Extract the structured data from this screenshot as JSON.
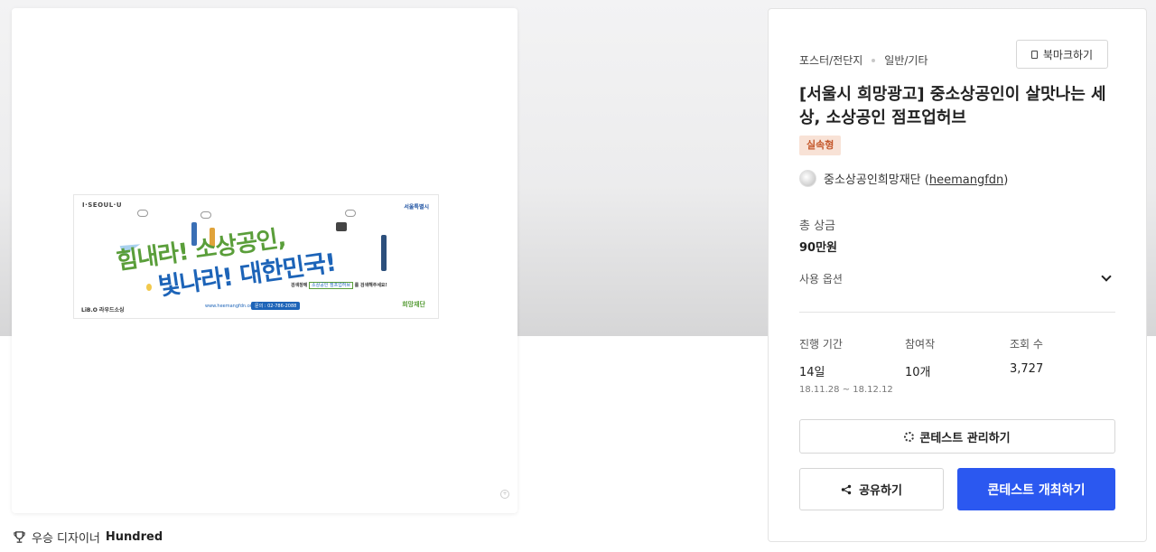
{
  "left": {
    "banner": {
      "top_left": "I·SEOUL·U",
      "top_right": "서울특별시",
      "headline_1": "힘내라! 소상공인,",
      "headline_2": "빛나라! 대한민국!",
      "search_prefix": "검색창에",
      "search_keyword": "소상공인 점프업허브",
      "search_suffix": "를 검색해주세요!",
      "bottom_left": "LiB.O 라우드소싱",
      "bottom_url": "www.heemangfdn.or.kr",
      "bottom_phone": "문의 : 02-786-2088",
      "bottom_right": "희망재단"
    },
    "designer_prefix": "우승 디자이너",
    "designer_name": "Hundred"
  },
  "panel": {
    "category_1": "포스터/전단지",
    "category_2": "일반/기타",
    "bookmark_label": "북마크하기",
    "title": "[서울시 희망광고] 중소상공인이 살맛나는 세상, 소상공인 점프업허브",
    "badge": "실속형",
    "host_name": "중소상공인희망재단",
    "host_handle_open": " (",
    "host_handle": "heemangfdn",
    "host_handle_close": ")",
    "prize_label": "총 상금",
    "prize_value": "90만원",
    "options_label": "사용 옵션",
    "stats": {
      "period_label": "진행 기간",
      "period_value": "14일",
      "period_range": "18.11.28 ~ 18.12.12",
      "entries_label": "참여작",
      "entries_value": "10개",
      "views_label": "조회 수",
      "views_value": "3,727"
    },
    "manage_label": "콘테스트 관리하기",
    "share_label": "공유하기",
    "host_button_label": "콘테스트 개최하기"
  },
  "colors": {
    "primary_button": "#2b58f0",
    "badge_bg": "#f8e2d6",
    "badge_text": "#c4572a"
  }
}
